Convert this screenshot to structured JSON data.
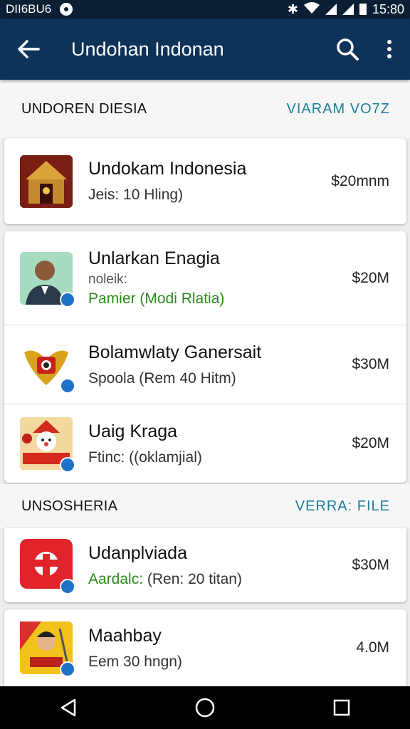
{
  "status_bar": {
    "carrier": "DII6BU6",
    "time": "15:80"
  },
  "app_bar": {
    "title": "Undohan Indonan"
  },
  "sections": [
    {
      "title": "UNDOREN DIESIA",
      "link": "VIARAM VO7Z"
    },
    {
      "title": "UNSOSHERIA",
      "link": "VERRA: FILE"
    }
  ],
  "items": [
    {
      "title": "Undokam Indonesia",
      "line": "Jeis: 10 Hling)",
      "price": "$20mnm"
    },
    {
      "title": "Unlarkan Enagia",
      "sub": "noleik:",
      "line": "Pamier  (Modi Rlatia)",
      "price": "$20M"
    },
    {
      "title": "Bolamwlaty Ganersait",
      "line": "Spoola  (Rem 40 Hitm)",
      "price": "$30M"
    },
    {
      "title": "Uaig Kraga",
      "line": "Ftinc:  ((oklamjial)",
      "price": "$20M"
    },
    {
      "title": "Udanplviada",
      "line_prefix": "Aardalc:",
      "line": "(Ren: 20 titan)",
      "price": "$30M"
    },
    {
      "title": "Maahbay",
      "line": "Eem 30 hngn)",
      "price": "4.0M"
    }
  ],
  "icons": {
    "back": "arrow-left-icon",
    "search": "search-icon",
    "menu": "more-vertical-icon",
    "nav": [
      "back-triangle-icon",
      "home-circle-icon",
      "recents-square-icon"
    ]
  },
  "colors": {
    "app_bar": "#0e3358",
    "status_bar": "#0a1f33",
    "link": "#1a7f96",
    "green_text": "#2b8a18",
    "badge": "#1e73c8"
  }
}
